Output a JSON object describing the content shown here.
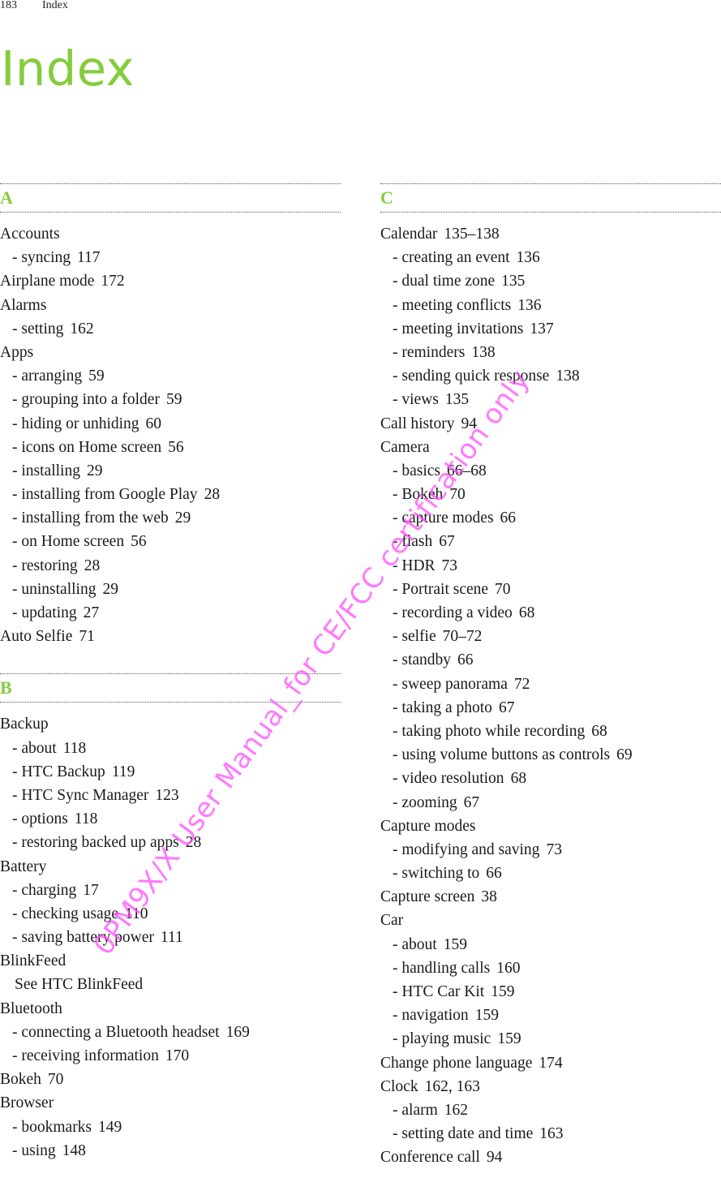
{
  "header": {
    "page_number": "183",
    "section": "Index"
  },
  "title": "Index",
  "colors": {
    "accent": "#84cc3c",
    "watermark": "#ff4dff"
  },
  "watermark": "0PM9X/X User Manual_for CE/FCC certification only",
  "columns": [
    [
      {
        "letter": "A",
        "entries": [
          {
            "text": "Accounts",
            "pages": "",
            "level": "main"
          },
          {
            "text": "- syncing",
            "pages": "117",
            "level": "sub"
          },
          {
            "text": "Airplane mode",
            "pages": "172",
            "level": "main"
          },
          {
            "text": "Alarms",
            "pages": "",
            "level": "main"
          },
          {
            "text": "- setting",
            "pages": "162",
            "level": "sub"
          },
          {
            "text": "Apps",
            "pages": "",
            "level": "main"
          },
          {
            "text": "- arranging",
            "pages": "59",
            "level": "sub"
          },
          {
            "text": "- grouping into a folder",
            "pages": "59",
            "level": "sub"
          },
          {
            "text": "- hiding or unhiding",
            "pages": "60",
            "level": "sub"
          },
          {
            "text": "- icons on Home screen",
            "pages": "56",
            "level": "sub"
          },
          {
            "text": "- installing",
            "pages": "29",
            "level": "sub"
          },
          {
            "text": "- installing from Google Play",
            "pages": "28",
            "level": "sub"
          },
          {
            "text": "- installing from the web",
            "pages": "29",
            "level": "sub"
          },
          {
            "text": "- on Home screen",
            "pages": "56",
            "level": "sub"
          },
          {
            "text": "- restoring",
            "pages": "28",
            "level": "sub"
          },
          {
            "text": "- uninstalling",
            "pages": "29",
            "level": "sub"
          },
          {
            "text": "- updating",
            "pages": "27",
            "level": "sub"
          },
          {
            "text": "Auto Selfie",
            "pages": "71",
            "level": "main"
          }
        ]
      },
      {
        "letter": "B",
        "entries": [
          {
            "text": "Backup",
            "pages": "",
            "level": "main"
          },
          {
            "text": "- about",
            "pages": "118",
            "level": "sub"
          },
          {
            "text": "- HTC Backup",
            "pages": "119",
            "level": "sub"
          },
          {
            "text": "- HTC Sync Manager",
            "pages": "123",
            "level": "sub"
          },
          {
            "text": "- options",
            "pages": "118",
            "level": "sub"
          },
          {
            "text": "- restoring backed up apps",
            "pages": "28",
            "level": "sub"
          },
          {
            "text": "Battery",
            "pages": "",
            "level": "main"
          },
          {
            "text": "- charging",
            "pages": "17",
            "level": "sub"
          },
          {
            "text": "- checking usage",
            "pages": "110",
            "level": "sub"
          },
          {
            "text": "- saving battery power",
            "pages": "111",
            "level": "sub"
          },
          {
            "text": "BlinkFeed",
            "pages": "",
            "level": "main"
          },
          {
            "text": "See HTC BlinkFeed",
            "pages": "",
            "level": "see"
          },
          {
            "text": "Bluetooth",
            "pages": "",
            "level": "main"
          },
          {
            "text": "- connecting a Bluetooth headset",
            "pages": "169",
            "level": "sub"
          },
          {
            "text": "- receiving information",
            "pages": "170",
            "level": "sub"
          },
          {
            "text": "Bokeh",
            "pages": "70",
            "level": "main"
          },
          {
            "text": "Browser",
            "pages": "",
            "level": "main"
          },
          {
            "text": "- bookmarks",
            "pages": "149",
            "level": "sub"
          },
          {
            "text": "- using",
            "pages": "148",
            "level": "sub"
          }
        ]
      }
    ],
    [
      {
        "letter": "C",
        "entries": [
          {
            "text": "Calendar",
            "pages": "135–138",
            "level": "main"
          },
          {
            "text": "- creating an event",
            "pages": "136",
            "level": "sub"
          },
          {
            "text": "- dual time zone",
            "pages": "135",
            "level": "sub"
          },
          {
            "text": "- meeting conflicts",
            "pages": "136",
            "level": "sub"
          },
          {
            "text": "- meeting invitations",
            "pages": "137",
            "level": "sub"
          },
          {
            "text": "- reminders",
            "pages": "138",
            "level": "sub"
          },
          {
            "text": "- sending quick response",
            "pages": "138",
            "level": "sub"
          },
          {
            "text": "- views",
            "pages": "135",
            "level": "sub"
          },
          {
            "text": "Call history",
            "pages": "94",
            "level": "main"
          },
          {
            "text": "Camera",
            "pages": "",
            "level": "main"
          },
          {
            "text": "- basics",
            "pages": "66–68",
            "level": "sub"
          },
          {
            "text": "- Bokeh",
            "pages": "70",
            "level": "sub"
          },
          {
            "text": "- capture modes",
            "pages": "66",
            "level": "sub"
          },
          {
            "text": "- flash",
            "pages": "67",
            "level": "sub"
          },
          {
            "text": "- HDR",
            "pages": "73",
            "level": "sub"
          },
          {
            "text": "- Portrait scene",
            "pages": "70",
            "level": "sub"
          },
          {
            "text": "- recording a video",
            "pages": "68",
            "level": "sub"
          },
          {
            "text": "- selfie",
            "pages": "70–72",
            "level": "sub"
          },
          {
            "text": "- standby",
            "pages": "66",
            "level": "sub"
          },
          {
            "text": "- sweep panorama",
            "pages": "72",
            "level": "sub"
          },
          {
            "text": "- taking a photo",
            "pages": "67",
            "level": "sub"
          },
          {
            "text": "- taking photo while recording",
            "pages": "68",
            "level": "sub"
          },
          {
            "text": "- using volume buttons as controls",
            "pages": "69",
            "level": "sub"
          },
          {
            "text": "- video resolution",
            "pages": "68",
            "level": "sub"
          },
          {
            "text": "- zooming",
            "pages": "67",
            "level": "sub"
          },
          {
            "text": "Capture modes",
            "pages": "",
            "level": "main"
          },
          {
            "text": "- modifying and saving",
            "pages": "73",
            "level": "sub"
          },
          {
            "text": "- switching to",
            "pages": "66",
            "level": "sub"
          },
          {
            "text": "Capture screen",
            "pages": "38",
            "level": "main"
          },
          {
            "text": "Car",
            "pages": "",
            "level": "main"
          },
          {
            "text": "- about",
            "pages": "159",
            "level": "sub"
          },
          {
            "text": "- handling calls",
            "pages": "160",
            "level": "sub"
          },
          {
            "text": "- HTC Car Kit",
            "pages": "159",
            "level": "sub"
          },
          {
            "text": "- navigation",
            "pages": "159",
            "level": "sub"
          },
          {
            "text": "- playing music",
            "pages": "159",
            "level": "sub"
          },
          {
            "text": "Change phone language",
            "pages": "174",
            "level": "main"
          },
          {
            "text": "Clock",
            "pages": "162, 163",
            "level": "main"
          },
          {
            "text": "- alarm",
            "pages": "162",
            "level": "sub"
          },
          {
            "text": "- setting date and time",
            "pages": "163",
            "level": "sub"
          },
          {
            "text": "Conference call",
            "pages": "94",
            "level": "main"
          }
        ]
      }
    ]
  ]
}
